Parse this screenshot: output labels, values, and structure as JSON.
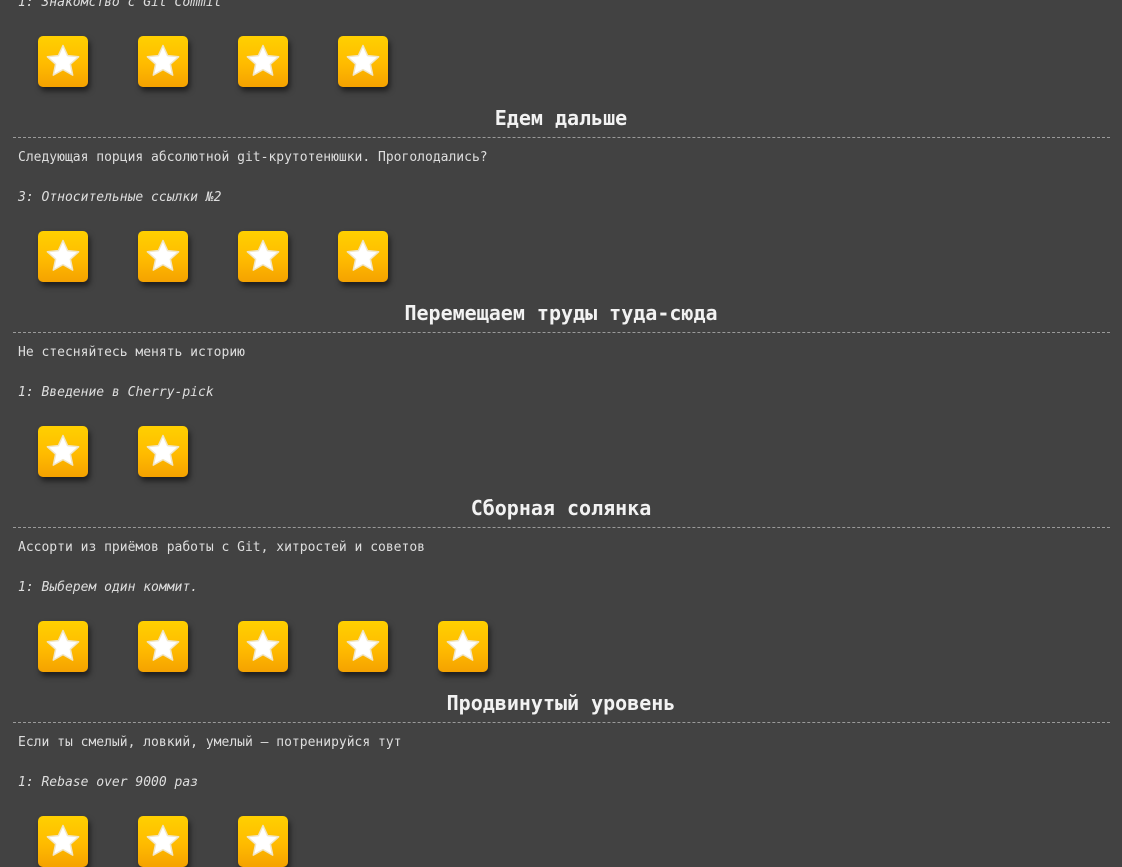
{
  "sequences": [
    {
      "level_label": "1: Знакомство с Git Commit",
      "stars": 4
    },
    {
      "title": "Едем дальше",
      "about": "Следующая порция абсолютной git-крутотенюшки. Проголодались?",
      "level_label": "3: Относительные ссылки №2",
      "stars": 4
    },
    {
      "title": "Перемещаем труды туда-сюда",
      "about": "Не стесняйтесь менять историю",
      "level_label": "1: Введение в Cherry-pick",
      "stars": 2
    },
    {
      "title": "Сборная солянка",
      "about": "Ассорти из приёмов работы с Git, хитростей и советов",
      "level_label": "1: Выберем один коммит.",
      "stars": 5
    },
    {
      "title": "Продвинутый уровень",
      "about": "Если ты смелый, ловкий, умелый – потренируйся тут",
      "level_label": "1: Rebase over 9000 раз",
      "stars": 3
    }
  ],
  "icon": "star-icon",
  "colors": {
    "background": "#424242",
    "star_tile": "#ffbb00",
    "star": "#ffffff"
  }
}
